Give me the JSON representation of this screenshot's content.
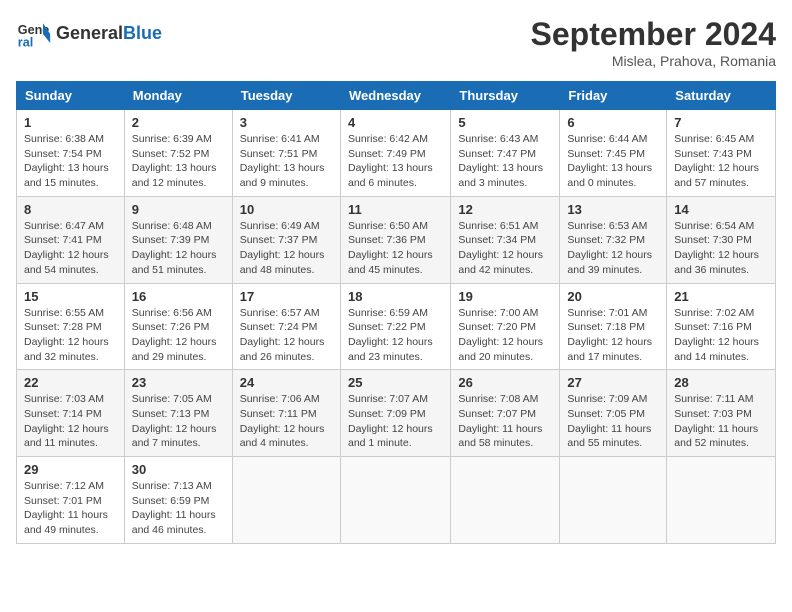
{
  "header": {
    "logo_line1": "General",
    "logo_line2": "Blue",
    "month": "September 2024",
    "location": "Mislea, Prahova, Romania"
  },
  "weekdays": [
    "Sunday",
    "Monday",
    "Tuesday",
    "Wednesday",
    "Thursday",
    "Friday",
    "Saturday"
  ],
  "weeks": [
    [
      {
        "day": "1",
        "sunrise": "6:38 AM",
        "sunset": "7:54 PM",
        "daylight": "13 hours and 15 minutes."
      },
      {
        "day": "2",
        "sunrise": "6:39 AM",
        "sunset": "7:52 PM",
        "daylight": "13 hours and 12 minutes."
      },
      {
        "day": "3",
        "sunrise": "6:41 AM",
        "sunset": "7:51 PM",
        "daylight": "13 hours and 9 minutes."
      },
      {
        "day": "4",
        "sunrise": "6:42 AM",
        "sunset": "7:49 PM",
        "daylight": "13 hours and 6 minutes."
      },
      {
        "day": "5",
        "sunrise": "6:43 AM",
        "sunset": "7:47 PM",
        "daylight": "13 hours and 3 minutes."
      },
      {
        "day": "6",
        "sunrise": "6:44 AM",
        "sunset": "7:45 PM",
        "daylight": "13 hours and 0 minutes."
      },
      {
        "day": "7",
        "sunrise": "6:45 AM",
        "sunset": "7:43 PM",
        "daylight": "12 hours and 57 minutes."
      }
    ],
    [
      {
        "day": "8",
        "sunrise": "6:47 AM",
        "sunset": "7:41 PM",
        "daylight": "12 hours and 54 minutes."
      },
      {
        "day": "9",
        "sunrise": "6:48 AM",
        "sunset": "7:39 PM",
        "daylight": "12 hours and 51 minutes."
      },
      {
        "day": "10",
        "sunrise": "6:49 AM",
        "sunset": "7:37 PM",
        "daylight": "12 hours and 48 minutes."
      },
      {
        "day": "11",
        "sunrise": "6:50 AM",
        "sunset": "7:36 PM",
        "daylight": "12 hours and 45 minutes."
      },
      {
        "day": "12",
        "sunrise": "6:51 AM",
        "sunset": "7:34 PM",
        "daylight": "12 hours and 42 minutes."
      },
      {
        "day": "13",
        "sunrise": "6:53 AM",
        "sunset": "7:32 PM",
        "daylight": "12 hours and 39 minutes."
      },
      {
        "day": "14",
        "sunrise": "6:54 AM",
        "sunset": "7:30 PM",
        "daylight": "12 hours and 36 minutes."
      }
    ],
    [
      {
        "day": "15",
        "sunrise": "6:55 AM",
        "sunset": "7:28 PM",
        "daylight": "12 hours and 32 minutes."
      },
      {
        "day": "16",
        "sunrise": "6:56 AM",
        "sunset": "7:26 PM",
        "daylight": "12 hours and 29 minutes."
      },
      {
        "day": "17",
        "sunrise": "6:57 AM",
        "sunset": "7:24 PM",
        "daylight": "12 hours and 26 minutes."
      },
      {
        "day": "18",
        "sunrise": "6:59 AM",
        "sunset": "7:22 PM",
        "daylight": "12 hours and 23 minutes."
      },
      {
        "day": "19",
        "sunrise": "7:00 AM",
        "sunset": "7:20 PM",
        "daylight": "12 hours and 20 minutes."
      },
      {
        "day": "20",
        "sunrise": "7:01 AM",
        "sunset": "7:18 PM",
        "daylight": "12 hours and 17 minutes."
      },
      {
        "day": "21",
        "sunrise": "7:02 AM",
        "sunset": "7:16 PM",
        "daylight": "12 hours and 14 minutes."
      }
    ],
    [
      {
        "day": "22",
        "sunrise": "7:03 AM",
        "sunset": "7:14 PM",
        "daylight": "12 hours and 11 minutes."
      },
      {
        "day": "23",
        "sunrise": "7:05 AM",
        "sunset": "7:13 PM",
        "daylight": "12 hours and 7 minutes."
      },
      {
        "day": "24",
        "sunrise": "7:06 AM",
        "sunset": "7:11 PM",
        "daylight": "12 hours and 4 minutes."
      },
      {
        "day": "25",
        "sunrise": "7:07 AM",
        "sunset": "7:09 PM",
        "daylight": "12 hours and 1 minute."
      },
      {
        "day": "26",
        "sunrise": "7:08 AM",
        "sunset": "7:07 PM",
        "daylight": "11 hours and 58 minutes."
      },
      {
        "day": "27",
        "sunrise": "7:09 AM",
        "sunset": "7:05 PM",
        "daylight": "11 hours and 55 minutes."
      },
      {
        "day": "28",
        "sunrise": "7:11 AM",
        "sunset": "7:03 PM",
        "daylight": "11 hours and 52 minutes."
      }
    ],
    [
      {
        "day": "29",
        "sunrise": "7:12 AM",
        "sunset": "7:01 PM",
        "daylight": "11 hours and 49 minutes."
      },
      {
        "day": "30",
        "sunrise": "7:13 AM",
        "sunset": "6:59 PM",
        "daylight": "11 hours and 46 minutes."
      },
      null,
      null,
      null,
      null,
      null
    ]
  ]
}
